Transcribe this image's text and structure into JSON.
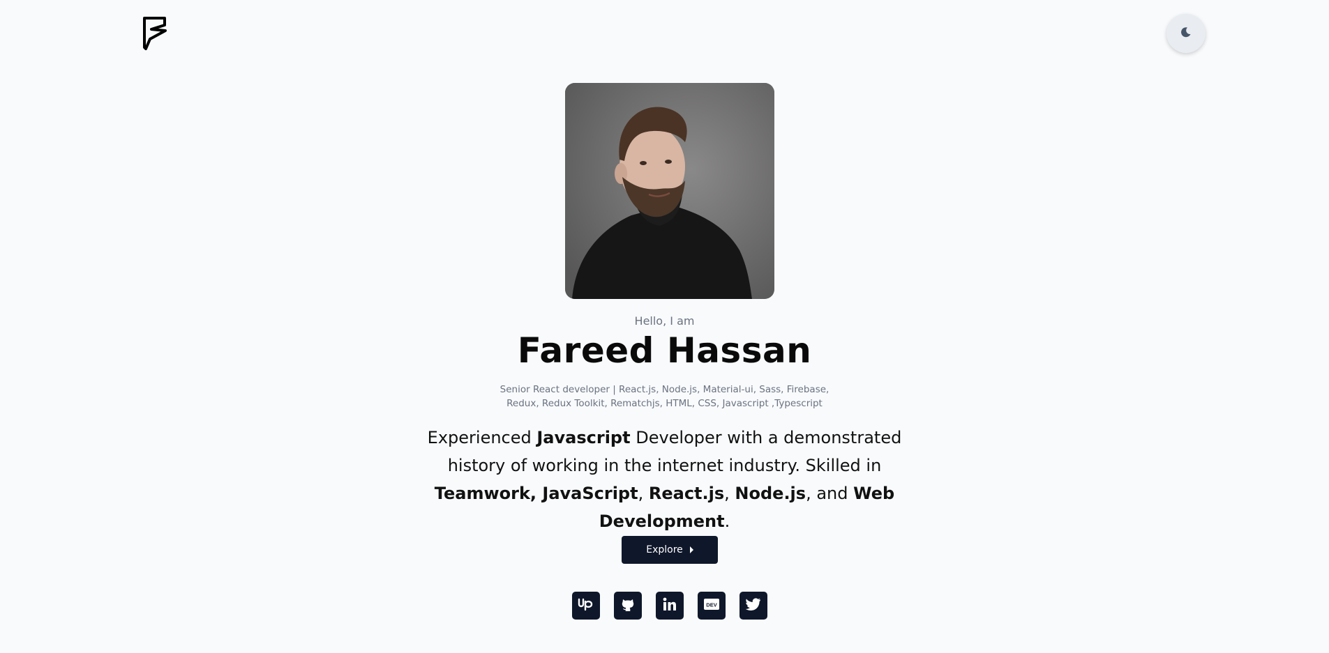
{
  "header": {
    "logo_letter": "F",
    "theme_toggle_icon": "moon-icon"
  },
  "hero": {
    "greeting": "Hello, I am",
    "name": "Fareed Hassan",
    "headline": "Senior React developer | React.js, Node.js, Material-ui, Sass, Firebase, Redux, Redux Toolkit, Rematchjs, HTML, CSS, Javascript ,Typescript",
    "bio": {
      "t1": "Experienced ",
      "b1": "Javascript",
      "t2": " Developer with a demonstrated history of working in the internet industry. Skilled in ",
      "b2": "Teamwork, JavaScript",
      "t3": ", ",
      "b3": "React.js",
      "t4": ", ",
      "b4": "Node.js",
      "t5": ", and ",
      "b5": "Web Development",
      "t6": "."
    },
    "explore_label": "Explore"
  },
  "socials": [
    {
      "icon": "upwork-icon",
      "glyph": "Up"
    },
    {
      "icon": "github-icon"
    },
    {
      "icon": "linkedin-icon",
      "glyph": "in"
    },
    {
      "icon": "dev-icon",
      "glyph": "DEV"
    },
    {
      "icon": "twitter-icon"
    }
  ],
  "colors": {
    "background": "#f8fafc",
    "button": "#0f172a",
    "muted_text": "#6b7280"
  }
}
